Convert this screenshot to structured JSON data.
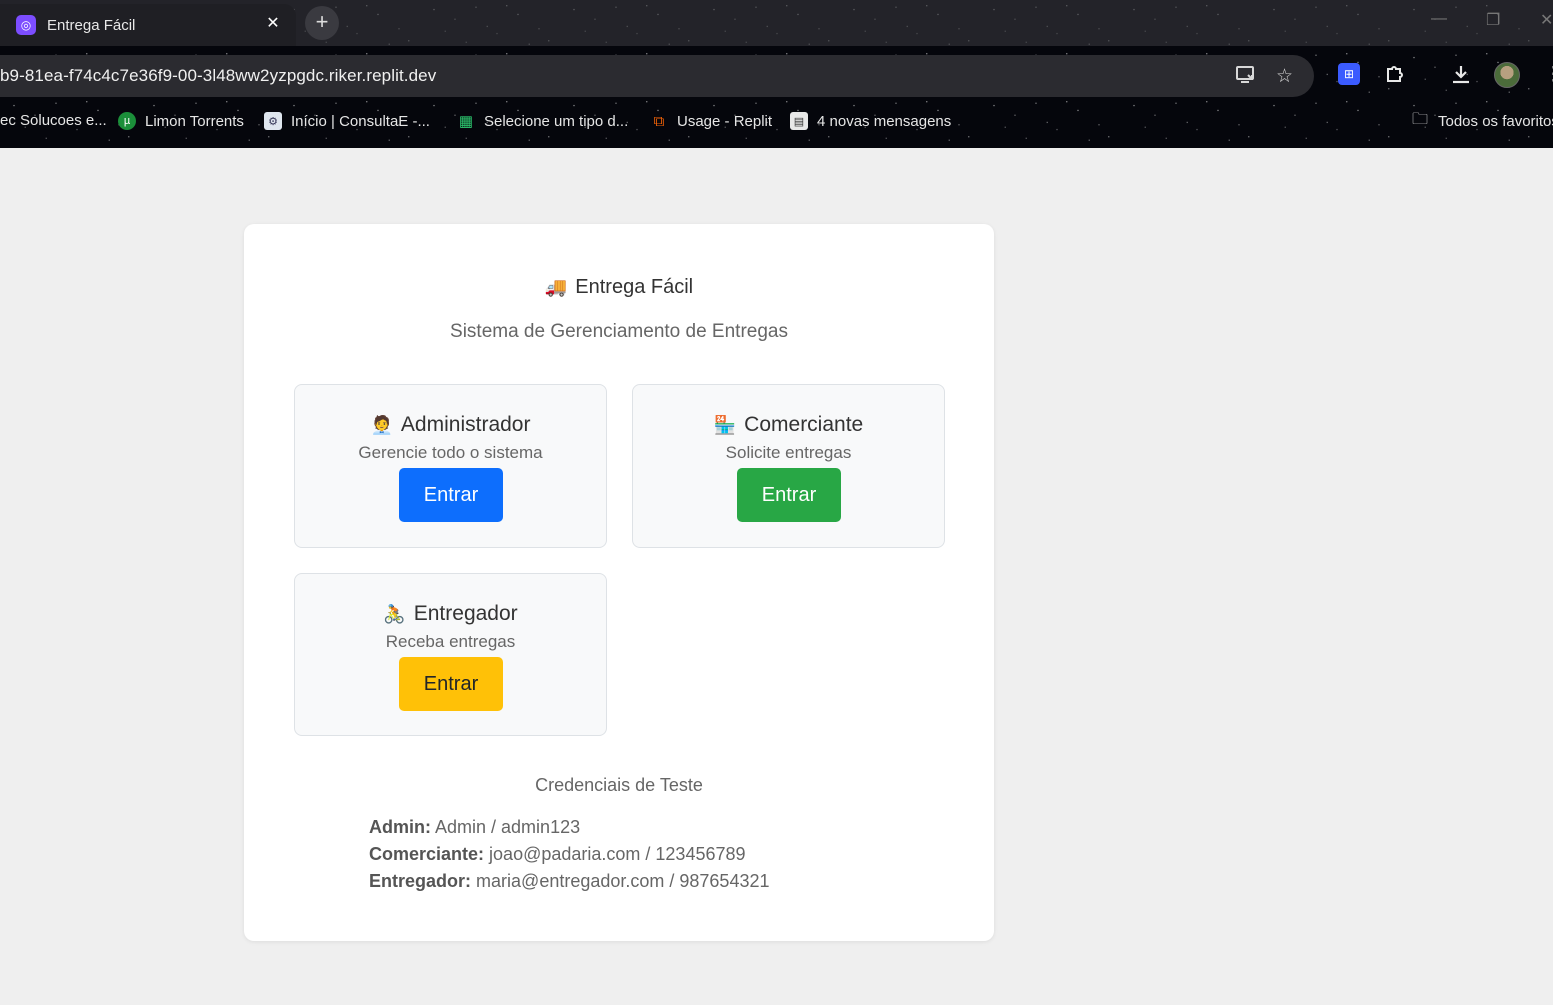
{
  "browser": {
    "tab": {
      "title": "Entrega Fácil",
      "favicon": "replit-icon",
      "close": "✕"
    },
    "new_tab": "+",
    "url": "b9-81ea-f74c4c7e36f9-00-3l48ww2yzpgdc.riker.replit.dev",
    "bookmarks": [
      {
        "label": "ec Solucoes e...",
        "icon": "bookmark-icon"
      },
      {
        "label": "Limon Torrents",
        "icon": "utorrent-icon"
      },
      {
        "label": "Início | ConsultaE -...",
        "icon": "consulta-icon"
      },
      {
        "label": "Selecione um tipo d...",
        "icon": "qr-icon"
      },
      {
        "label": "Usage - Replit",
        "icon": "replit-icon"
      },
      {
        "label": "4 novas mensagens",
        "icon": "clipboard-icon"
      }
    ],
    "all_bookmarks": "Todos os favoritos"
  },
  "app": {
    "title_emoji": "🚚",
    "title": "Entrega Fácil",
    "subtitle": "Sistema de Gerenciamento de Entregas",
    "roles": [
      {
        "emoji": "🧑‍💼",
        "name": "Administrador",
        "desc": "Gerencie todo o sistema",
        "button": "Entrar",
        "color": "#0d6efd",
        "text_color": "#ffffff"
      },
      {
        "emoji": "🏪",
        "name": "Comerciante",
        "desc": "Solicite entregas",
        "button": "Entrar",
        "color": "#28a745",
        "text_color": "#ffffff"
      },
      {
        "emoji": "🚴",
        "name": "Entregador",
        "desc": "Receba entregas",
        "button": "Entrar",
        "color": "#ffc107",
        "text_color": "#212529"
      }
    ],
    "credentials": {
      "title": "Credenciais de Teste",
      "items": [
        {
          "label": "Admin:",
          "value": "Admin / admin123"
        },
        {
          "label": "Comerciante:",
          "value": "joao@padaria.com / 123456789"
        },
        {
          "label": "Entregador:",
          "value": "maria@entregador.com / 987654321"
        }
      ]
    }
  },
  "colors": {
    "page_bg": "#efefef",
    "card_bg": "#ffffff",
    "role_bg": "#f8f9fa"
  }
}
